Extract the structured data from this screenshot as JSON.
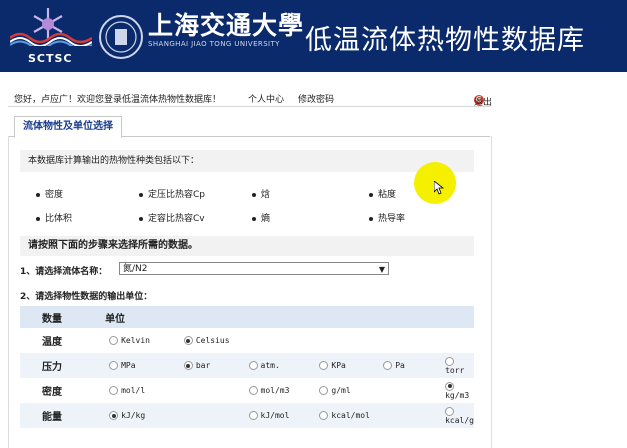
{
  "header": {
    "logo_text": "SCTSC",
    "university_cn": "上海交通大學",
    "university_en": "SHANGHAI JIAO TONG UNIVERSITY",
    "db_title": "低温流体热物性数据库",
    "bg_color": "#0b2a6b"
  },
  "userbar": {
    "welcome": "您好，卢应广！欢迎您登录低温流体热物性数据库！",
    "personal_center": "个人中心",
    "change_password": "修改密码",
    "logout": "退出"
  },
  "tab": {
    "label": "流体物性及单位选择"
  },
  "intro": "本数据库计算输出的热物性种类包括以下：",
  "properties": [
    "密度",
    "定压比热容Cp",
    "焓",
    "粘度",
    "比体积",
    "定容比热容Cv",
    "熵",
    "热导率"
  ],
  "steps_title": "请按照下面的步骤来选择所需的数据。",
  "step1": {
    "label": "1、请选择流体名称：",
    "selected": "氮/N2"
  },
  "step2": {
    "label": "2、请选择物性数据的输出单位："
  },
  "units_table": {
    "header": {
      "quantity": "数量",
      "unit": "单位"
    },
    "rows": [
      {
        "name": "温度",
        "options": [
          "Kelvin",
          "Celsius"
        ],
        "selected": 1
      },
      {
        "name": "压力",
        "options": [
          "MPa",
          "bar",
          "atm.",
          "KPa",
          "Pa",
          "torr"
        ],
        "selected": 1
      },
      {
        "name": "密度",
        "options": [
          "mol/l",
          "mol/m3",
          "g/ml",
          "kg/m3"
        ],
        "selected": 3
      },
      {
        "name": "能量",
        "options": [
          "kJ/kg",
          "kJ/mol",
          "kcal/mol",
          "kcal/g"
        ],
        "selected": 0
      }
    ]
  }
}
